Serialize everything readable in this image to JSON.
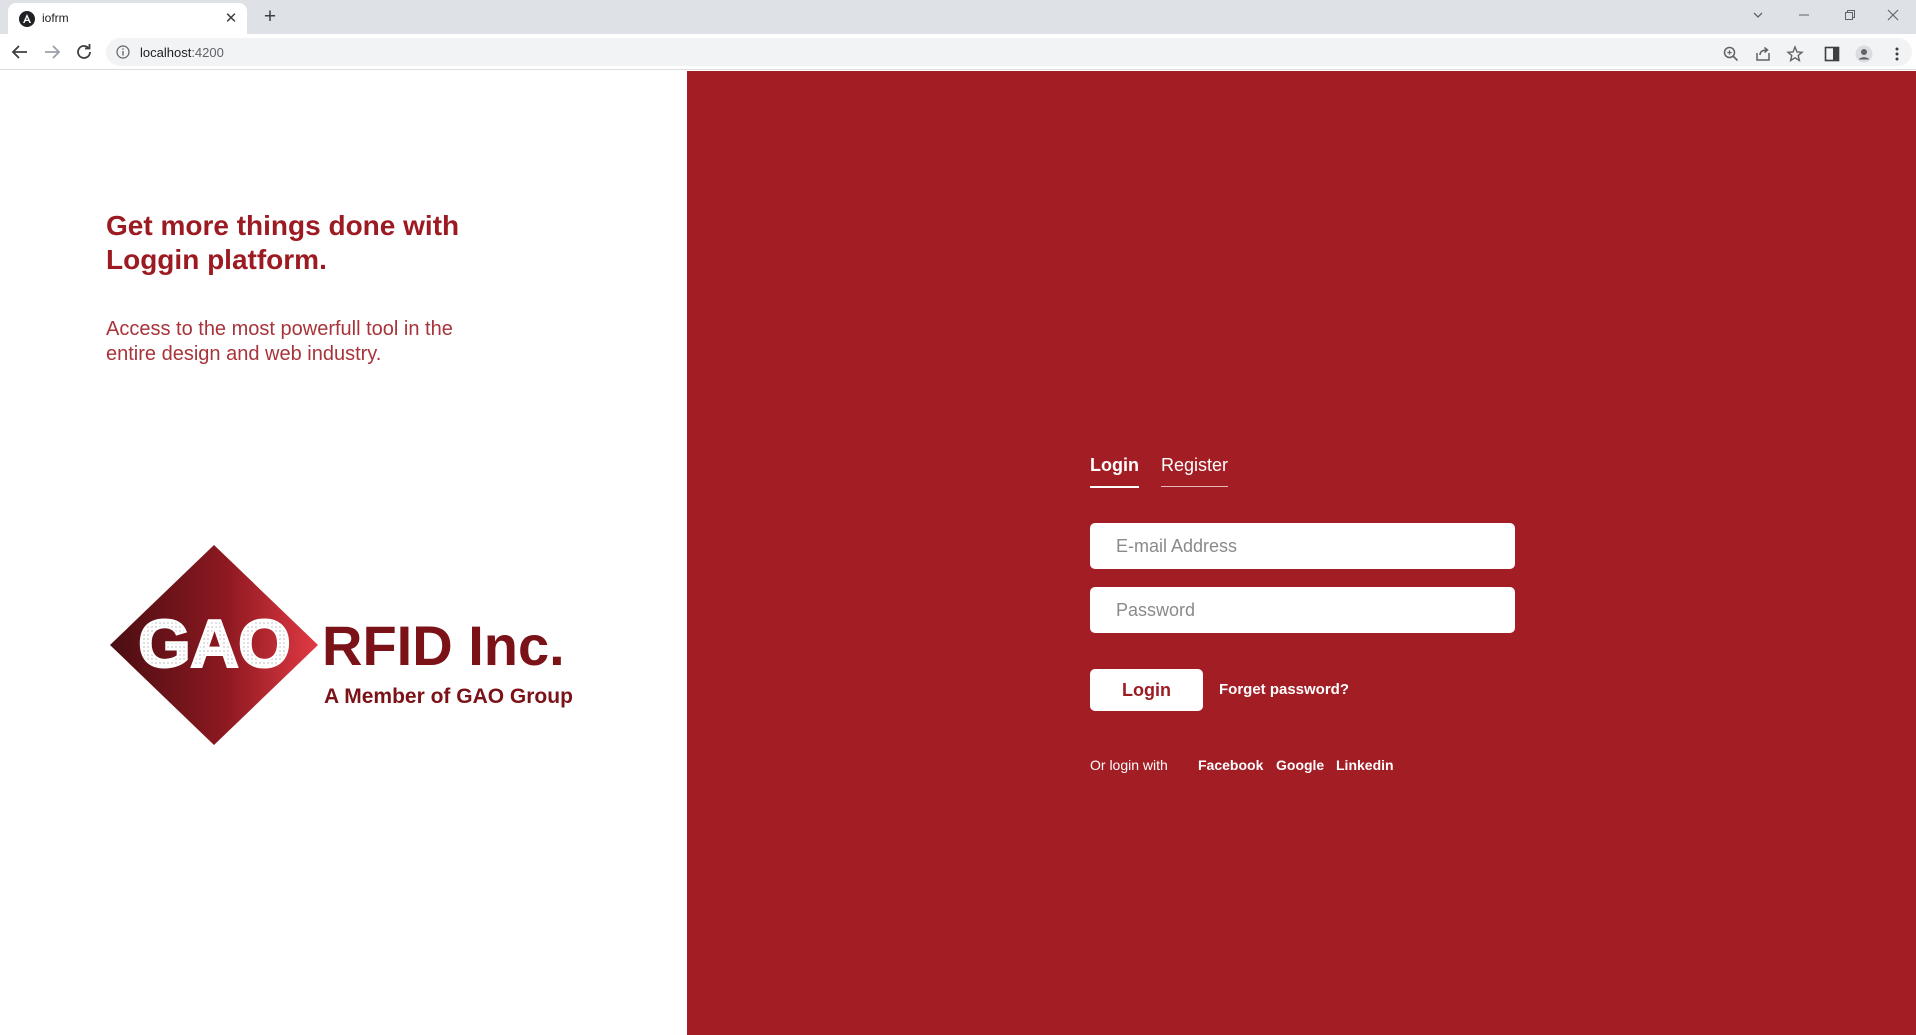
{
  "browser": {
    "tab_title": "iofrm",
    "new_tab_symbol": "+",
    "url_host": "localhost",
    "url_port": ":4200"
  },
  "left": {
    "headline_line1": "Get more things done with",
    "headline_line2": "Loggin platform.",
    "subtext_line1": "Access to the most powerfull tool in the",
    "subtext_line2": "entire design and web industry.",
    "logo": {
      "mark": "GAO",
      "company": "RFID Inc.",
      "tagline": "A Member of GAO Group"
    }
  },
  "auth": {
    "tabs": [
      {
        "label": "Login",
        "active": true
      },
      {
        "label": "Register",
        "active": false
      }
    ],
    "email_placeholder": "E-mail Address",
    "password_placeholder": "Password",
    "login_button": "Login",
    "forget_link": "Forget password?",
    "or_login_with": "Or login with",
    "social": [
      "Facebook",
      "Google",
      "Linkedin"
    ]
  },
  "colors": {
    "brand_red": "#a21d24",
    "text_red": "#9c1b22",
    "white": "#ffffff"
  }
}
